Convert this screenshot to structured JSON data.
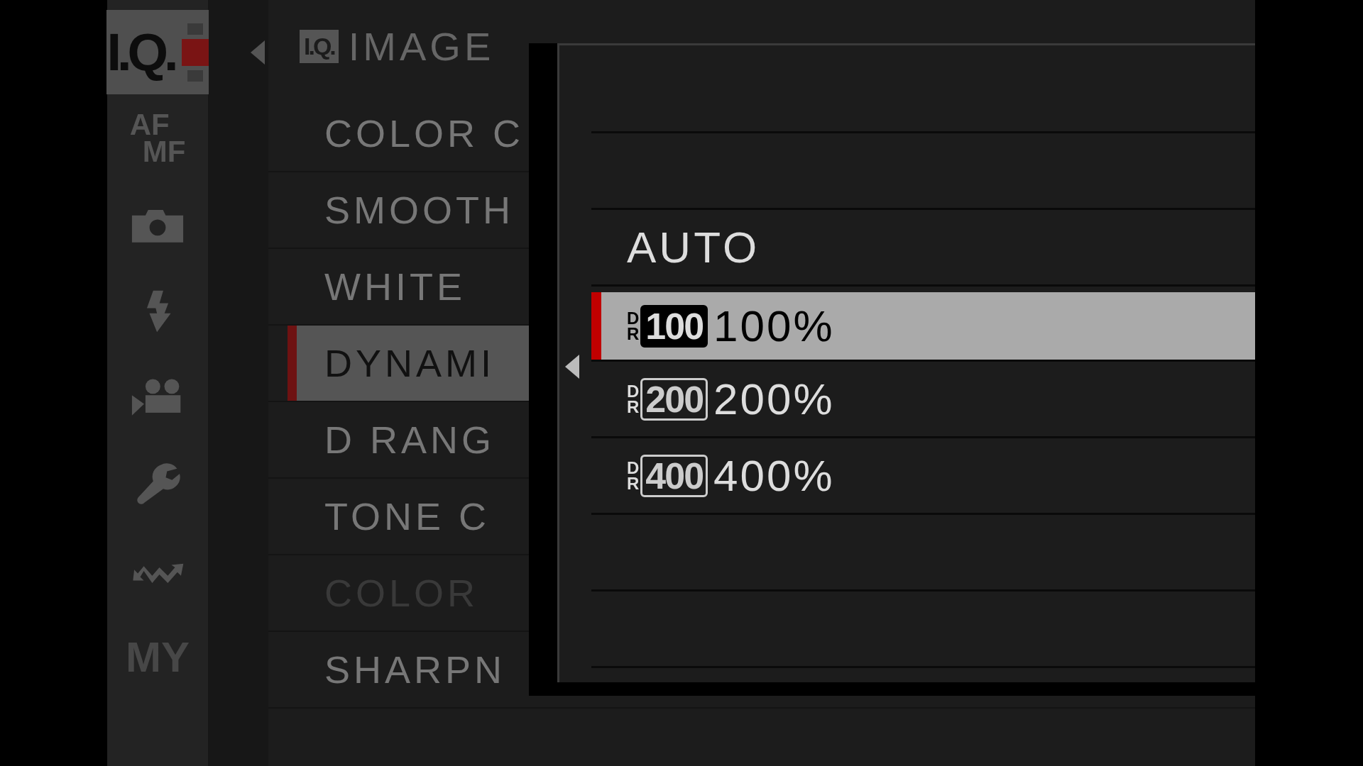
{
  "tabs": [
    {
      "kind": "iq",
      "label": "I.Q.",
      "selected": true,
      "disabled": false
    },
    {
      "kind": "text",
      "lines": [
        "AF",
        "MF"
      ],
      "selected": false,
      "disabled": false
    },
    {
      "kind": "camera",
      "selected": false,
      "disabled": false
    },
    {
      "kind": "flash",
      "selected": false,
      "disabled": false
    },
    {
      "kind": "movie",
      "selected": false,
      "disabled": false
    },
    {
      "kind": "wrench",
      "selected": false,
      "disabled": false
    },
    {
      "kind": "arrows",
      "selected": false,
      "disabled": false
    },
    {
      "kind": "text",
      "lines": [
        "MY"
      ],
      "selected": false,
      "disabled": true
    }
  ],
  "header": {
    "icon_label": "I.Q.",
    "title": "IMAGE"
  },
  "menu": [
    {
      "label": "COLOR C",
      "selected": false,
      "disabled": false
    },
    {
      "label": "SMOOTH",
      "selected": false,
      "disabled": false
    },
    {
      "label": "WHITE",
      "selected": false,
      "disabled": false
    },
    {
      "label": "DYNAMI",
      "selected": true,
      "disabled": false
    },
    {
      "label": "D RANG",
      "selected": false,
      "disabled": false
    },
    {
      "label": "TONE C",
      "selected": false,
      "disabled": false
    },
    {
      "label": "COLOR",
      "selected": false,
      "disabled": true
    },
    {
      "label": "SHARPN",
      "selected": false,
      "disabled": false
    }
  ],
  "popup": {
    "options": [
      {
        "kind": "empty"
      },
      {
        "kind": "empty"
      },
      {
        "kind": "text",
        "label": "AUTO",
        "selected": false
      },
      {
        "kind": "dr",
        "letters": [
          "D",
          "R"
        ],
        "number": "100",
        "label": "100%",
        "selected": true
      },
      {
        "kind": "dr",
        "letters": [
          "D",
          "R"
        ],
        "number": "200",
        "label": "200%",
        "selected": false
      },
      {
        "kind": "dr",
        "letters": [
          "D",
          "R"
        ],
        "number": "400",
        "label": "400%",
        "selected": false
      },
      {
        "kind": "empty"
      },
      {
        "kind": "empty"
      }
    ]
  }
}
